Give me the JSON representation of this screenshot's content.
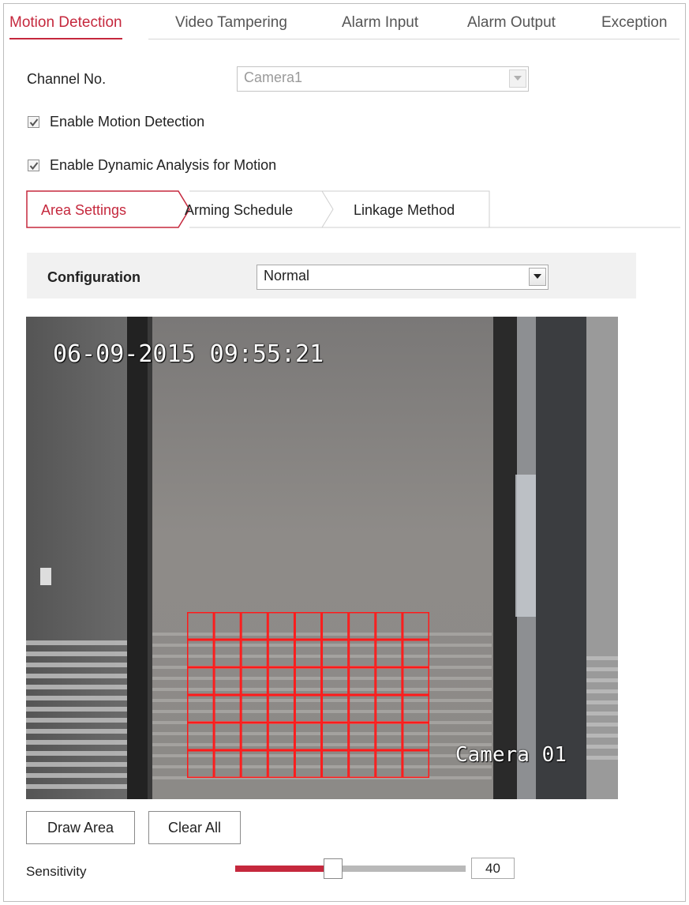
{
  "top_tabs": [
    {
      "label": "Motion Detection",
      "active": true
    },
    {
      "label": "Video Tampering",
      "active": false
    },
    {
      "label": "Alarm Input",
      "active": false
    },
    {
      "label": "Alarm Output",
      "active": false
    },
    {
      "label": "Exception",
      "active": false
    }
  ],
  "channel": {
    "label": "Channel No.",
    "value": "Camera1",
    "disabled": true
  },
  "enable_motion": {
    "label": "Enable Motion Detection",
    "checked": true
  },
  "enable_dynamic": {
    "label": "Enable Dynamic Analysis for Motion",
    "checked": true
  },
  "sub_tabs": [
    {
      "label": "Area Settings",
      "active": true
    },
    {
      "label": "Arming Schedule",
      "active": false
    },
    {
      "label": "Linkage Method",
      "active": false
    }
  ],
  "configuration": {
    "label": "Configuration",
    "value": "Normal"
  },
  "video": {
    "timestamp": "06-09-2015 09:55:21",
    "camera_name": "Camera 01",
    "detection_grid": {
      "columns": 9,
      "rows": 6
    }
  },
  "buttons": {
    "draw_area": "Draw Area",
    "clear_all": "Clear All"
  },
  "sensitivity": {
    "label": "Sensitivity",
    "value": "40",
    "level_percent": 40
  },
  "colors": {
    "accent": "#c5283d",
    "grid": "#ff1a1a"
  }
}
